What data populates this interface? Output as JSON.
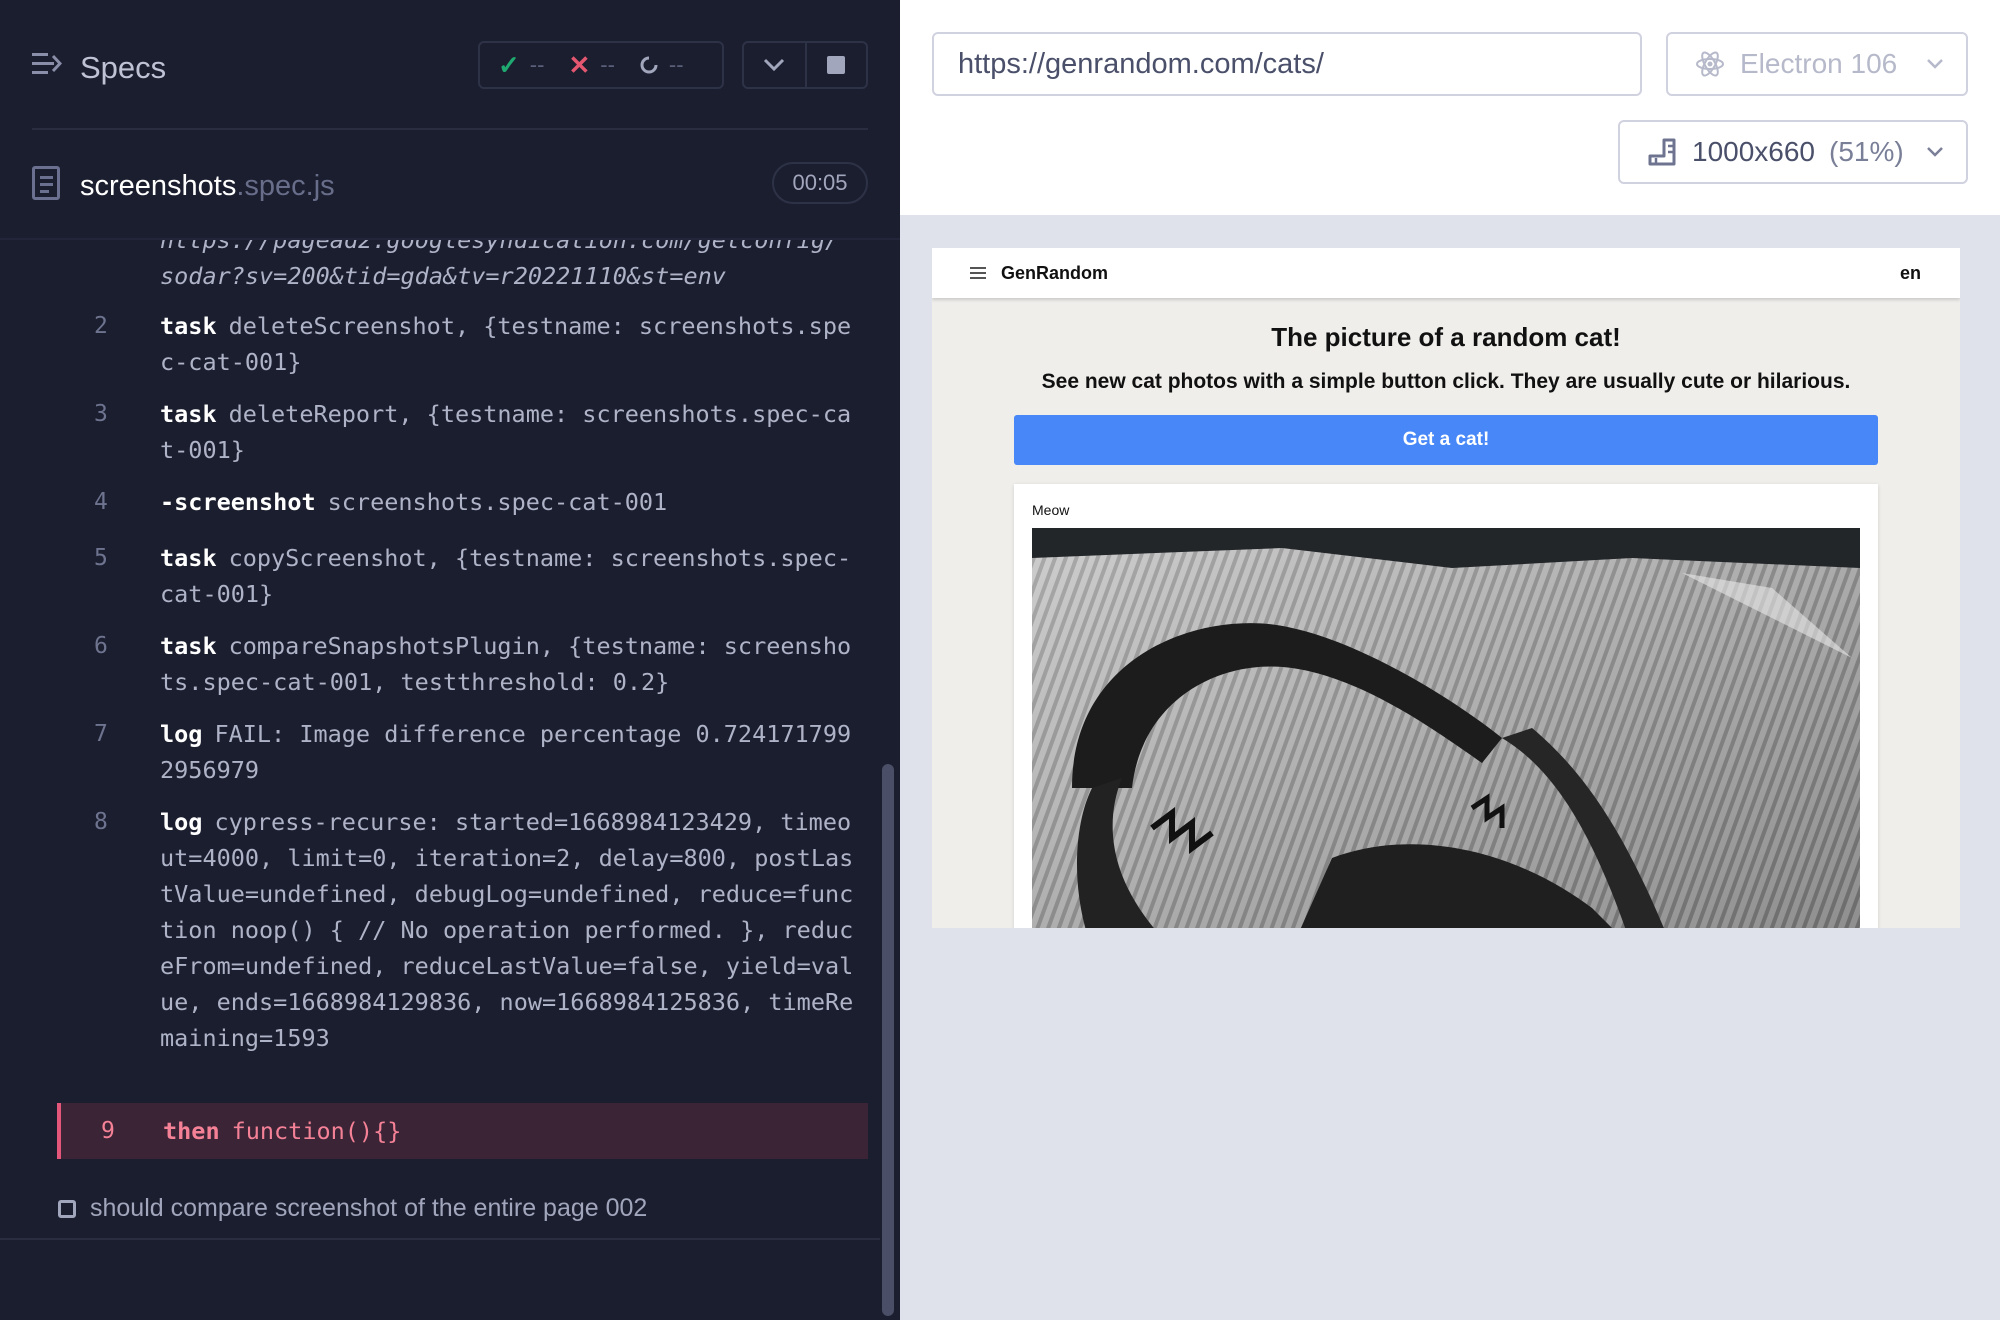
{
  "runner": {
    "title": "Specs",
    "stats": {
      "passed": "--",
      "failed": "--",
      "pending": "--"
    },
    "spec": {
      "name": "screenshots",
      "ext": ".spec.js",
      "duration": "00:05"
    },
    "log": {
      "cut_line_1": "https://pagead2.googlesyndication.com/getconfig/",
      "cut_line_2": "sodar?sv=200&tid=gda&tv=r20221110&st=env",
      "items": [
        {
          "num": "2",
          "cmd": "task",
          "msg": "deleteScreenshot, {testname: screenshots.spec-cat-001}"
        },
        {
          "num": "3",
          "cmd": "task",
          "msg": "deleteReport, {testname: screenshots.spec-cat-001}"
        },
        {
          "num": "4",
          "cmd": "-screenshot",
          "msg": "screenshots.spec-cat-001"
        },
        {
          "num": "5",
          "cmd": "task",
          "msg": "copyScreenshot, {testname: screenshots.spec-cat-001}"
        },
        {
          "num": "6",
          "cmd": "task",
          "msg": "compareSnapshotsPlugin, {testname: screenshots.spec-cat-001, testthreshold: 0.2}"
        },
        {
          "num": "7",
          "cmd": "log",
          "msg": "FAIL: Image difference percentage 0.7241717992956979"
        },
        {
          "num": "8",
          "cmd": "log",
          "msg": "cypress-recurse: started=1668984123429, timeout=4000, limit=0, iteration=2, delay=800, postLastValue=undefined, debugLog=undefined, reduce=function noop() { // No operation performed. }, reduceFrom=undefined, reduceLastValue=false, yield=value, ends=1668984129836, now=1668984125836, timeRemaining=1593"
        },
        {
          "num": "9",
          "cmd": "then",
          "msg": "function(){}"
        }
      ]
    },
    "next_test": "should compare screenshot of the entire page 002"
  },
  "browser": {
    "url": "https://genrandom.com/cats/",
    "name": "Electron 106",
    "viewport": "1000x660",
    "scale": "(51%)"
  },
  "aut": {
    "brand": "GenRandom",
    "lang": "en",
    "title": "The picture of a random cat!",
    "subtitle": "See new cat photos with a simple button click. They are usually cute or hilarious.",
    "button": "Get a cat!",
    "card_label": "Meow"
  },
  "colors": {
    "pass": "#1fa971",
    "fail": "#e45770",
    "accent_button": "#4787f7",
    "fail_row_bg": "#3a2436"
  }
}
